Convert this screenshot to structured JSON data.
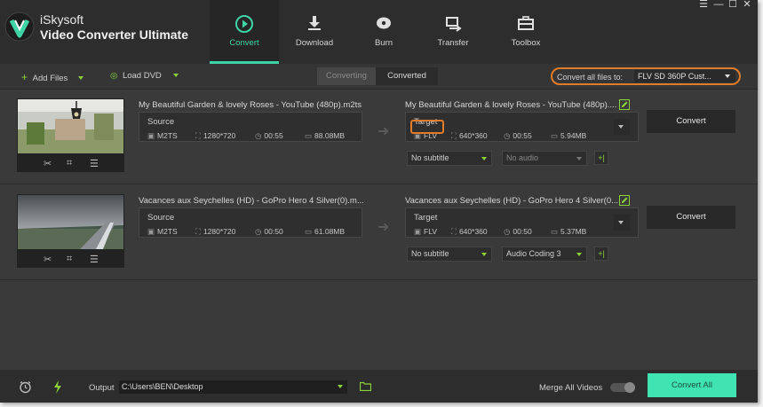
{
  "app": {
    "brand_line1": "iSkysoft",
    "brand_line2": "Video Converter Ultimate"
  },
  "nav": [
    {
      "label": "Convert",
      "icon": "convert-icon",
      "active": true
    },
    {
      "label": "Download",
      "icon": "download-icon"
    },
    {
      "label": "Burn",
      "icon": "burn-icon"
    },
    {
      "label": "Transfer",
      "icon": "transfer-icon"
    },
    {
      "label": "Toolbox",
      "icon": "toolbox-icon"
    }
  ],
  "window_controls": {
    "menu": "☰",
    "minimize": "—",
    "maximize": "☐",
    "close": "✕"
  },
  "toolbar": {
    "add_files": "Add Files",
    "load_dvd": "Load DVD",
    "tab_converting": "Converting",
    "tab_converted": "Converted",
    "convert_all_label": "Convert all files to:",
    "convert_all_value": "FLV SD 360P Cust..."
  },
  "files": [
    {
      "source_title": "My Beautiful Garden & lovely Roses - YouTube (480p).m2ts",
      "source_heading": "Source",
      "source_format": "M2TS",
      "source_resolution": "1280*720",
      "source_duration": "00:55",
      "source_size": "88.08MB",
      "target_title": "My Beautiful Garden & lovely Roses - YouTube (480p)....",
      "target_heading": "Target",
      "target_format": "FLV",
      "target_resolution": "640*360",
      "target_duration": "00:55",
      "target_size": "5.94MB",
      "subtitle": "No subtitle",
      "audio": "No audio",
      "convert_label": "Convert"
    },
    {
      "source_title": "Vacances aux Seychelles (HD) - GoPro Hero 4 Silver(0).m...",
      "source_heading": "Source",
      "source_format": "M2TS",
      "source_resolution": "1280*720",
      "source_duration": "00:50",
      "source_size": "61.08MB",
      "target_title": "Vacances aux Seychelles (HD) - GoPro Hero 4 Silver(0...",
      "target_heading": "Target",
      "target_format": "FLV",
      "target_resolution": "640*360",
      "target_duration": "00:50",
      "target_size": "5.37MB",
      "subtitle": "No subtitle",
      "audio": "Audio Coding 3",
      "convert_label": "Convert"
    }
  ],
  "bottom": {
    "output_label": "Output",
    "output_path": "C:\\Users\\BEN\\Desktop",
    "merge_label": "Merge All Videos",
    "convert_all_button": "Convert All"
  },
  "colors": {
    "accent": "#3fd4a6",
    "highlight": "#e07b2a",
    "green_icon": "#8bd13a"
  }
}
